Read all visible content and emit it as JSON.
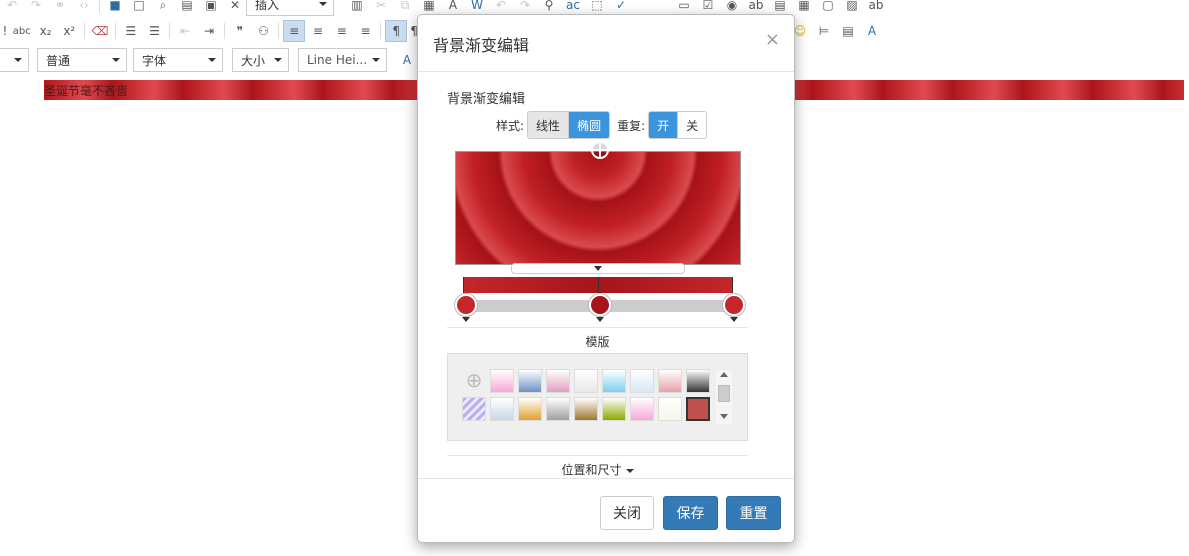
{
  "toolbar": {
    "insert_label": "插入",
    "paragraph_select": "普通",
    "font_select": "字体",
    "size_select": "大小",
    "line_height_select": "Line Hei..."
  },
  "document": {
    "banner_text": "圣诞节毫不吝啬"
  },
  "dialog": {
    "title": "背景渐变编辑",
    "section_label": "背景渐变编辑",
    "style_label": "样式:",
    "style_options": [
      "线性",
      "椭圆"
    ],
    "style_selected": "椭圆",
    "repeat_label": "重复:",
    "repeat_options": [
      "开",
      "关"
    ],
    "repeat_selected": "开",
    "templates_label": "模版",
    "position_size_label": "位置和尺寸",
    "close_button": "关闭",
    "save_button": "保存",
    "reset_button": "重置",
    "close_icon": "×"
  },
  "gradient_stops": [
    {
      "color": "#c4262b",
      "position": 0
    },
    {
      "color": "#a5151a",
      "position": 0.5
    },
    {
      "color": "#c4262b",
      "position": 1
    }
  ],
  "template_swatches": [
    [
      "add",
      "#f7a8d8",
      "#6c92c4",
      "#e0a0c0",
      "#e8e8e8",
      "#7ccff0",
      "#d8e8f8",
      "#e8a0a8",
      "#333333"
    ],
    [
      "stripes",
      "#c8d8e8",
      "#e0a030",
      "#a0a0a0",
      "#a07830",
      "#8fa800",
      "#f7a8d8",
      "#f5f5e8",
      "#c0504d"
    ]
  ]
}
